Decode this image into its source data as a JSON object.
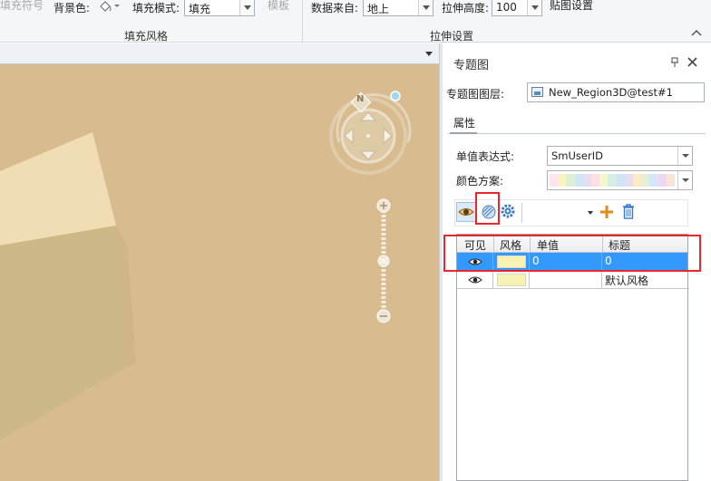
{
  "ribbon": {
    "fill_symbol_label": "填充符号",
    "bg_color_label": "背景色:",
    "fill_mode_label": "填充模式:",
    "fill_mode_value": "填充",
    "template_label": "模板",
    "fill_style_group": "填充风格",
    "data_source_label": "数据来自:",
    "data_source_value": "地上",
    "extrude_height_label": "拉伸高度:",
    "extrude_height_value": "100",
    "texture_settings_label": "贴图设置",
    "extrude_settings_group": "拉伸设置"
  },
  "panel": {
    "title": "专题图",
    "pin_icon": "pin-icon",
    "close_icon": "close-icon",
    "layer_label": "专题图图层:",
    "layer_value": "New_Region3D@test#1",
    "properties_tab": "属性",
    "expression_label": "单值表达式:",
    "expression_value": "SmUserID",
    "color_scheme_label": "颜色方案:",
    "color_scheme_colors": [
      "#fde4f0",
      "#fdf3c0",
      "#dff0d0",
      "#cfe6f5",
      "#e8dcf2",
      "#fce0e6",
      "#f6f7c9",
      "#d6efe3",
      "#d2e3f6",
      "#eadcf0",
      "#fdeac9",
      "#e3f1d2",
      "#d5e8f7",
      "#ecd8ef",
      "#fbe4d6"
    ],
    "grid": {
      "headers": [
        "可见",
        "风格",
        "单值",
        "标题"
      ],
      "rows": [
        {
          "value": "0",
          "caption": "0",
          "selected": true
        },
        {
          "value": "",
          "caption": "默认风格",
          "selected": false
        }
      ]
    }
  },
  "colors": {
    "map_background": "#d8bb8f",
    "selection": "#3399ff",
    "highlight_box": "#e8262b"
  }
}
